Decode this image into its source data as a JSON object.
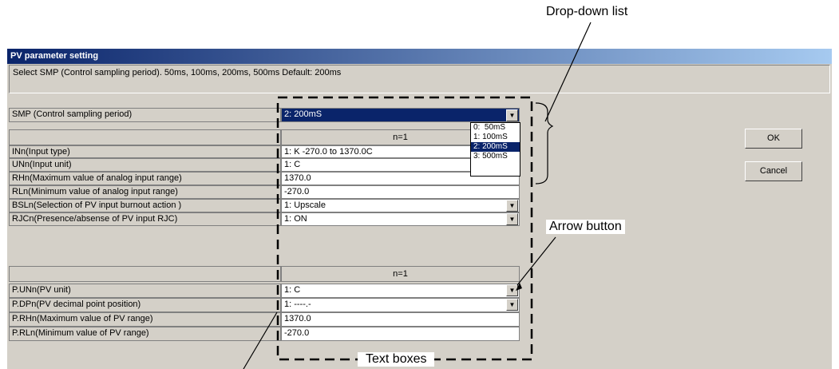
{
  "callouts": {
    "dropdown": "Drop-down list",
    "arrow": "Arrow button",
    "textboxes": "Text boxes"
  },
  "dialog": {
    "title": "PV parameter setting",
    "description": "Select SMP (Control sampling period).  50ms, 100ms, 200ms, 500ms  Default: 200ms",
    "ok": "OK",
    "cancel": "Cancel"
  },
  "smp": {
    "label": "SMP (Control sampling period)",
    "value": "2: 200mS"
  },
  "dropdown_options": [
    "0:  50mS",
    "1: 100mS",
    "2: 200mS",
    "3: 500mS"
  ],
  "group1": {
    "header": "n=1",
    "rows": [
      {
        "label": "INn(Input type)",
        "value": "1: K  -270.0 to 1370.0C"
      },
      {
        "label": "UNn(Input unit)",
        "value": "1: C"
      },
      {
        "label": "RHn(Maximum value of analog input range)",
        "value": "1370.0"
      },
      {
        "label": "RLn(Minimum value of analog input range)",
        "value": "-270.0"
      },
      {
        "label": "BSLn(Selection of PV input burnout action )",
        "value": "1: Upscale"
      },
      {
        "label": "RJCn(Presence/absense of PV input RJC)",
        "value": "1: ON"
      }
    ]
  },
  "group2": {
    "header": "n=1",
    "rows": [
      {
        "label": "P.UNn(PV unit)",
        "value": "1: C"
      },
      {
        "label": "P.DPn(PV decimal point position)",
        "value": "1:    ----.-"
      },
      {
        "label": "P.RHn(Maximum value of PV range)",
        "value": "1370.0"
      },
      {
        "label": "P.RLn(Minimum value of PV range)",
        "value": "-270.0"
      }
    ]
  }
}
